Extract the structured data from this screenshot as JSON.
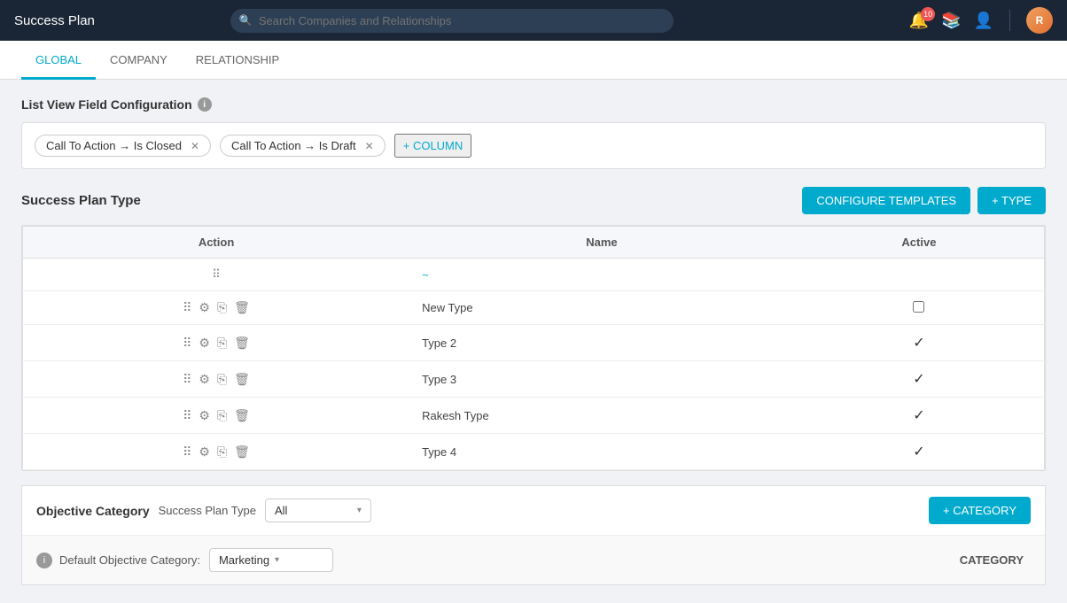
{
  "app": {
    "title": "Success Plan"
  },
  "search": {
    "placeholder": "Search Companies and Relationships"
  },
  "nav_icons": {
    "bell_badge": "10",
    "avatar_initials": "R"
  },
  "tabs": [
    {
      "id": "global",
      "label": "GLOBAL",
      "active": true
    },
    {
      "id": "company",
      "label": "COMPANY",
      "active": false
    },
    {
      "id": "relationship",
      "label": "RELATIONSHIP",
      "active": false
    }
  ],
  "list_view": {
    "section_title": "List View Field Configuration",
    "filter_tags": [
      {
        "id": "tag1",
        "text": "Call To Action → Is Closed"
      },
      {
        "id": "tag2",
        "text": "Call To Action → Is Draft"
      }
    ],
    "add_column_label": "+ COLUMN"
  },
  "success_plan_type": {
    "section_title": "Success Plan Type",
    "configure_templates_label": "CONFIGURE TEMPLATES",
    "add_type_label": "+ TYPE",
    "table": {
      "columns": [
        "Action",
        "Name",
        "Active"
      ],
      "rows": [
        {
          "name": "New Type",
          "active": false
        },
        {
          "name": "Type 2",
          "active": true
        },
        {
          "name": "Type 3",
          "active": true
        },
        {
          "name": "Rakesh Type",
          "active": true
        },
        {
          "name": "Type 4",
          "active": true
        }
      ]
    }
  },
  "objective_category": {
    "section_title": "Objective Category",
    "filter_label": "Success Plan Type",
    "filter_value": "All",
    "add_category_label": "+ CATEGORY",
    "default_objective_label": "Default Objective Category:",
    "default_objective_value": "Marketing",
    "columns_header": "CATEGORY"
  }
}
